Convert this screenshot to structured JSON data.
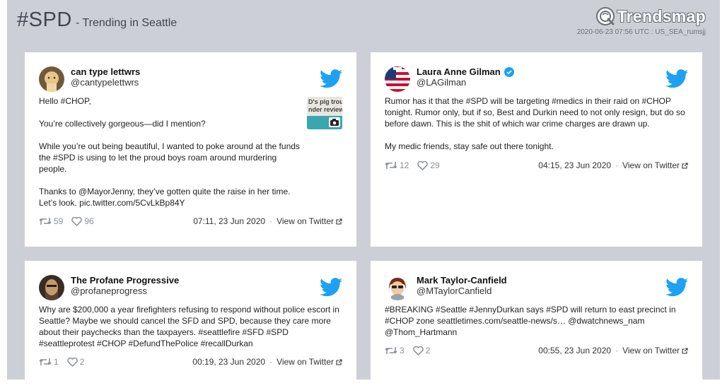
{
  "header": {
    "hashtag": "#SPD",
    "subtitle": "- Trending in Seattle",
    "brand": "Trendsmap",
    "meta": "2020-06-23 07:56 UTC : US_SEA_rumsjj"
  },
  "colors": {
    "twitter_blue": "#1da1f2",
    "background": "#cdcfd6",
    "card": "#ffffff"
  },
  "tweets": [
    {
      "name": "can type lettwrs",
      "handle": "@cantypelettwrs",
      "verified": false,
      "paragraphs": [
        "Hello #CHOP,",
        "You’re collectively gorgeous—did I mention?",
        "While you’re out being beautiful, I wanted to poke around at the funds the #SPD is using to let the proud boys roam around murdering people.",
        "Thanks to @MayorJenny, they’ve gotten quite the raise in her time. Let’s look. pic.twitter.com/5CvLkBp84Y"
      ],
      "thumb_lines": [
        "D's pig trou",
        "nder review"
      ],
      "retweets": "59",
      "likes": "96",
      "time": "07:11, 23 Jun 2020",
      "link": "View on Twitter"
    },
    {
      "name": "Laura Anne Gilman",
      "handle": "@LAGilman",
      "verified": true,
      "paragraphs": [
        "Rumor has it that the #SPD will be targeting #medics in their raid on #CHOP tonight. Rumor only, but if so, Best and Durkin need to not only resign, but do so before dawn. This is the shit of which war crime charges are drawn up.",
        "My medic friends, stay safe out there tonight."
      ],
      "retweets": "12",
      "likes": "29",
      "time": "04:15, 23 Jun 2020",
      "link": "View on Twitter"
    },
    {
      "name": "The Profane Progressive",
      "handle": "@profaneprogress",
      "verified": false,
      "paragraphs": [
        "Why are $200,000 a year firefighters refusing to respond without police escort in Seattle? Maybe we should cancel the SFD and SPD, because they care more about their paychecks than the taxpayers. #seattlefire #SFD #SPD #seattleprotest #CHOP #DefundThePolice #recallDurkan"
      ],
      "retweets": "1",
      "likes": "2",
      "time": "00:19, 23 Jun 2020",
      "link": "View on Twitter"
    },
    {
      "name": "Mark Taylor-Canfield",
      "handle": "@MTaylorCanfield",
      "verified": false,
      "paragraphs": [
        "#BREAKING #Seattle #JennyDurkan says #SPD will return to east precinct in #CHOP zone seattletimes.com/seattle-news/s… @dwatchnews_nam @Thom_Hartmann"
      ],
      "retweets": "3",
      "likes": "2",
      "time": "00:55, 23 Jun 2020",
      "link": "View on Twitter"
    }
  ]
}
